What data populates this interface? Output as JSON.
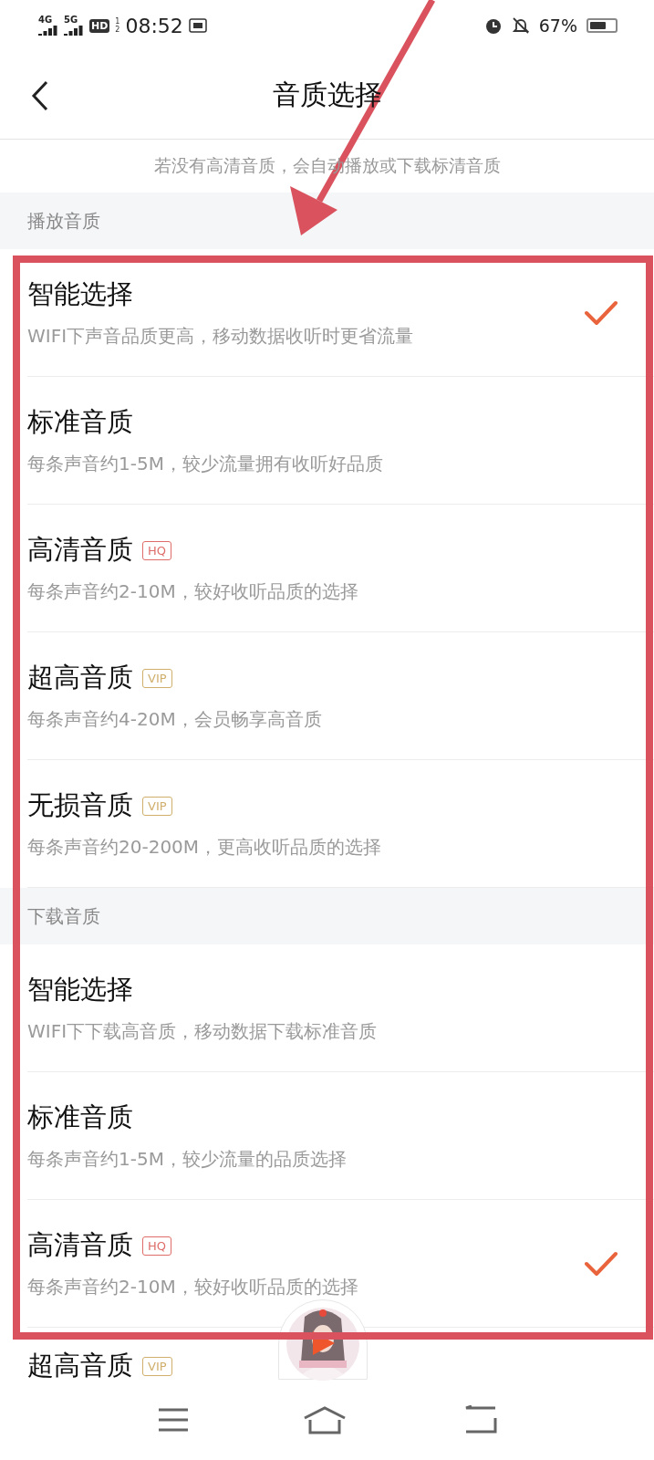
{
  "status_bar": {
    "network_1": "4G",
    "network_2": "5G",
    "hd": "HD",
    "sim_1": "1",
    "sim_2": "2",
    "time": "08:52",
    "battery_text": "67%"
  },
  "header": {
    "title": "音质选择"
  },
  "notice": "若没有高清音质，会自动播放或下载标清音质",
  "sections": [
    {
      "title": "播放音质",
      "items": [
        {
          "title": "智能选择",
          "subtitle": "WIFI下声音品质更高，移动数据收听时更省流量",
          "selected": true
        },
        {
          "title": "标准音质",
          "subtitle": "每条声音约1-5M，较少流量拥有收听好品质",
          "selected": false
        },
        {
          "title": "高清音质",
          "badge": {
            "text": "HQ",
            "kind": "hq"
          },
          "subtitle": "每条声音约2-10M，较好收听品质的选择",
          "selected": false
        },
        {
          "title": "超高音质",
          "badge": {
            "text": "VIP",
            "kind": "vip"
          },
          "subtitle": "每条声音约4-20M，会员畅享高音质",
          "selected": false
        },
        {
          "title": "无损音质",
          "badge": {
            "text": "VIP",
            "kind": "vip"
          },
          "subtitle": "每条声音约20-200M，更高收听品质的选择",
          "selected": false
        }
      ]
    },
    {
      "title": "下载音质",
      "items": [
        {
          "title": "智能选择",
          "subtitle": "WIFI下下载高音质，移动数据下载标准音质",
          "selected": false
        },
        {
          "title": "标准音质",
          "subtitle": "每条声音约1-5M，较少流量的品质选择",
          "selected": false
        },
        {
          "title": "高清音质",
          "badge": {
            "text": "HQ",
            "kind": "hq"
          },
          "subtitle": "每条声音约2-10M，较好收听品质的选择",
          "selected": true
        },
        {
          "title": "超高音质",
          "badge": {
            "text": "VIP",
            "kind": "vip"
          },
          "selected": false
        }
      ]
    }
  ]
}
